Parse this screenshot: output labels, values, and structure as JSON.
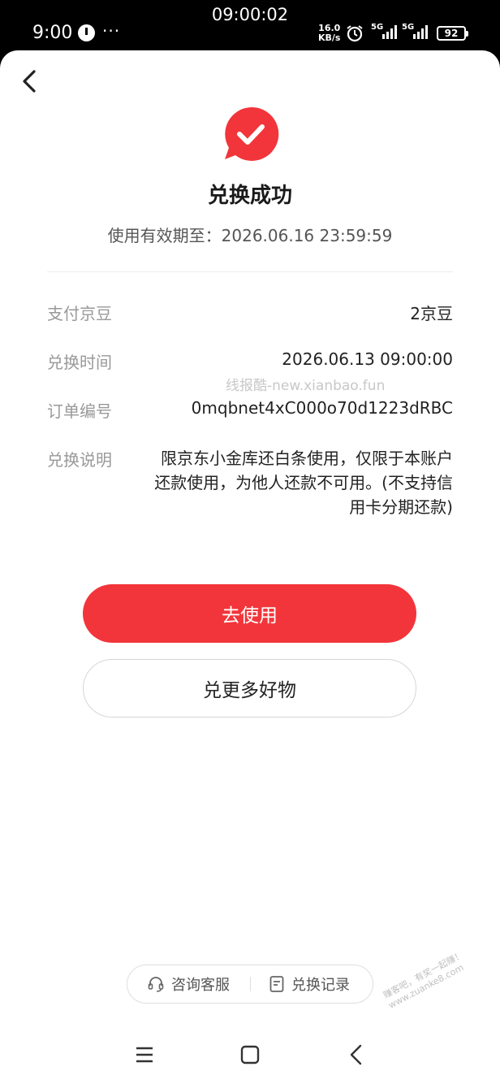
{
  "status_bar": {
    "time": "9:00",
    "more": "···",
    "center_clock": "09:00:02",
    "speed_value": "16.0",
    "speed_unit": "KB/s",
    "signal1": "5G",
    "signal2": "5G",
    "battery": "92"
  },
  "page": {
    "title": "兑换成功",
    "validity": "使用有效期至：2026.06.16 23:59:59"
  },
  "details": [
    {
      "label": "支付京豆",
      "value": "2京豆"
    },
    {
      "label": "兑换时间",
      "value": "2026.06.13 09:00:00"
    },
    {
      "label": "订单编号",
      "value": "0mqbnet4xC000o70d1223dRBC"
    },
    {
      "label": "兑换说明",
      "value": "限京东小金库还白条使用，仅限于本账户还款使用，为他人还款不可用。(不支持信用卡分期还款)"
    }
  ],
  "watermark": "线报酷-new.xianbao.fun",
  "buttons": {
    "primary": "去使用",
    "secondary": "兑更多好物"
  },
  "bottom_links": {
    "service": "咨询客服",
    "records": "兑换记录"
  },
  "corner_watermark": {
    "line1": "赚客吧，有奖一起赚！",
    "line2": "www.zuanke8.com"
  },
  "colors": {
    "accent": "#f2353a"
  },
  "icons": {
    "back": "chevron-left-icon",
    "success": "check-chat-bubble-icon",
    "service": "headset-icon",
    "records": "document-list-icon"
  }
}
